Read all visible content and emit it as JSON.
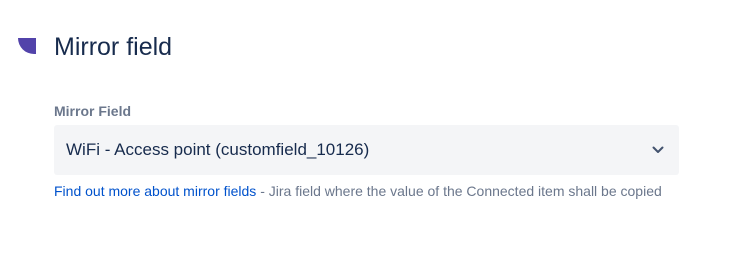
{
  "section": {
    "title": "Mirror field",
    "icon": "quarter-circle-icon",
    "icon_color": "#5243aa"
  },
  "field": {
    "label": "Mirror Field",
    "selected_value": "WiFi - Access point (customfield_10126)",
    "chevron_icon": "chevron-down-icon"
  },
  "helper": {
    "link_text": "Find out more about mirror fields",
    "description": " - Jira field where the value of the Connected item shall be copied"
  },
  "colors": {
    "text_primary": "#172b4d",
    "text_secondary": "#6b778c",
    "link": "#0052cc",
    "select_bg": "#f4f5f7"
  }
}
